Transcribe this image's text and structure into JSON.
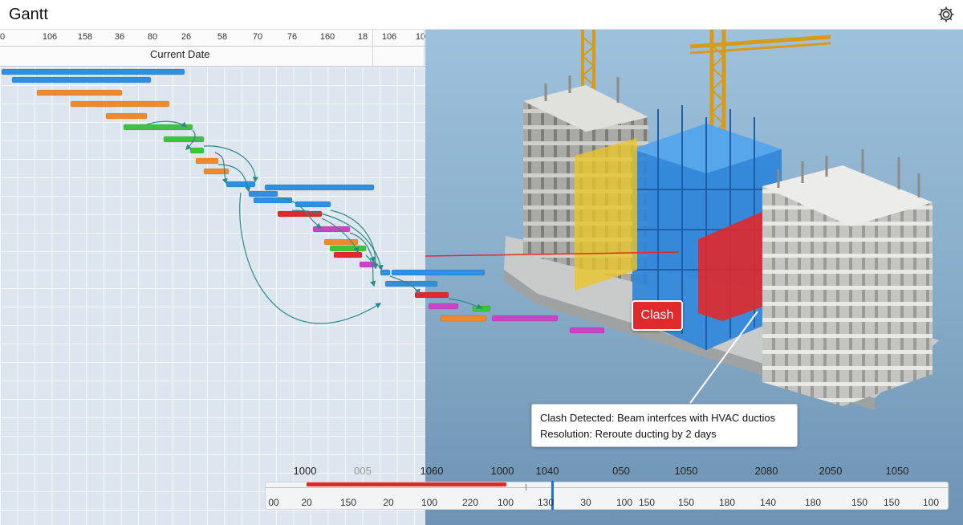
{
  "app": {
    "title": "Gantt"
  },
  "gantt": {
    "header_ticks": [
      "0",
      "106",
      "158",
      "36",
      "80",
      "26",
      "58",
      "70",
      "76",
      "160",
      "18",
      "106",
      "10"
    ],
    "current_date_label": "Current Date"
  },
  "clash": {
    "badge": "Clash",
    "detail_line1": "Clash Detected: Beam interfces with HVAC ductios",
    "detail_line2": "Resolution: Reroute ducting by 2 days"
  },
  "timeline": {
    "top_labels": [
      "1000",
      "005",
      "1060",
      "1000",
      "1040",
      "050",
      "1050",
      "2080",
      "2050",
      "1050"
    ],
    "bottom_labels": [
      "00",
      "20",
      "150",
      "20",
      "100",
      "220",
      "100",
      "130",
      "30",
      "100",
      "150",
      "150",
      "180",
      "140",
      "180",
      "150",
      "150",
      "100"
    ]
  },
  "colors": {
    "blue": "#2f8fe0",
    "orange": "#ee8a2e",
    "green": "#3cc43c",
    "red": "#e0292b",
    "magenta": "#c844c8",
    "yellow": "#e8c62a"
  }
}
